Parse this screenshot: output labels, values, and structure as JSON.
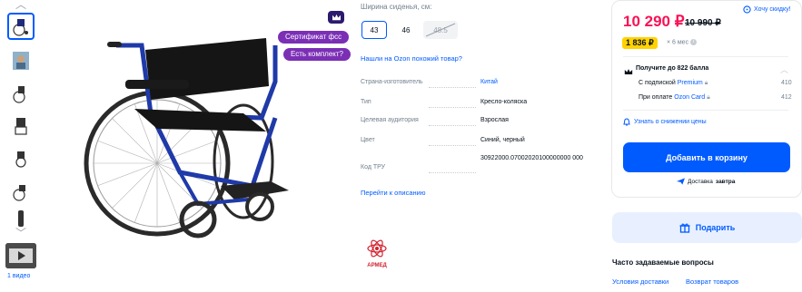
{
  "gallery": {
    "video_label": "1 видео"
  },
  "badges": {
    "certificate": "Сертификат фсс",
    "kit": "Есть комплект?"
  },
  "seat_width": {
    "label": "Ширина сиденья, см:",
    "options": [
      {
        "value": "43",
        "state": "selected"
      },
      {
        "value": "46",
        "state": "normal"
      },
      {
        "value": "48.5",
        "state": "disabled"
      }
    ]
  },
  "similar_link": "Нашли на Ozon похожий товар?",
  "specs": [
    {
      "label": "Страна-изготовитель",
      "value": "Китай",
      "link": true
    },
    {
      "label": "Тип",
      "value": "Кресло-коляска",
      "link": false
    },
    {
      "label": "Целевая аудитория",
      "value": "Взрослая",
      "link": false
    },
    {
      "label": "Цвет",
      "value": "Синий, черный",
      "link": false
    },
    {
      "label": "Код ТРУ",
      "value": "30922000.07002020100000000 000",
      "link": false
    }
  ],
  "description_link": "Перейти к описанию",
  "brand_logo_text": "АРМЕД",
  "price": {
    "current": "10 290 ₽",
    "old": "10 990 ₽",
    "want_discount": "Хочу скидку!",
    "installment_amount": "1 836 ₽",
    "installment_note": "× 6 мес",
    "points_title": "Получите до 822 балла",
    "points_rows": [
      {
        "label": "С подпиской",
        "highlight": "Premium",
        "value": "410"
      },
      {
        "label": "При оплате",
        "highlight": "Ozon Card",
        "value": "412"
      }
    ],
    "price_alert": "Узнать о снижении цены",
    "add_to_cart": "Добавить в корзину",
    "delivery_prefix": "Доставка",
    "delivery_when": "завтра",
    "gift": "Подарить"
  },
  "faq": {
    "title": "Часто задаваемые вопросы",
    "links": [
      "Условия доставки",
      "Возврат товаров"
    ]
  },
  "colors": {
    "accent": "#005bff",
    "price": "#f91155",
    "installment": "#ffd200",
    "badge": "#7b2fb5"
  }
}
